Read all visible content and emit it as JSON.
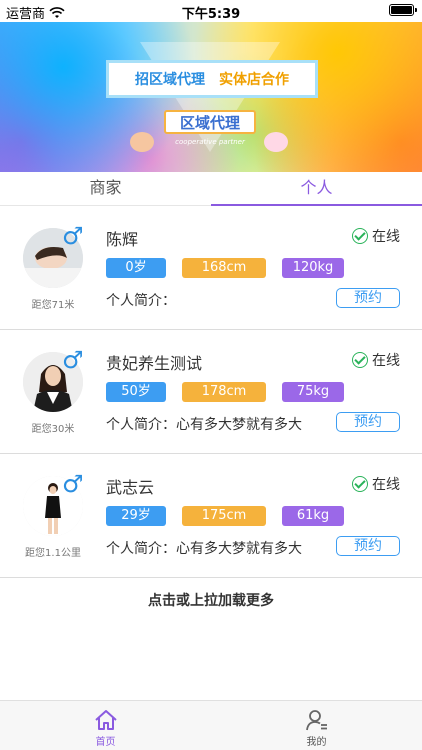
{
  "status_bar": {
    "carrier": "运营商",
    "time": "下午5:39"
  },
  "banner": {
    "headline_left": "招区域代理",
    "headline_right": "实体店合作",
    "subtitle": "区域代理",
    "caption": "cooperative partner"
  },
  "tabs": [
    {
      "label": "商家",
      "active": false
    },
    {
      "label": "个人",
      "active": true
    }
  ],
  "cards": [
    {
      "name": "陈辉",
      "status": "在线",
      "age": "0岁",
      "height": "168cm",
      "weight": "120kg",
      "intro_label": "个人简介：",
      "intro_text": "",
      "book_label": "预约",
      "distance": "距您71米",
      "gender_symbol": "♂"
    },
    {
      "name": "贵妃养生测试",
      "status": "在线",
      "age": "50岁",
      "height": "178cm",
      "weight": "75kg",
      "intro_label": "个人简介：",
      "intro_text": "心有多大梦就有多大",
      "book_label": "预约",
      "distance": "距您30米",
      "gender_symbol": "♂"
    },
    {
      "name": "武志云",
      "status": "在线",
      "age": "29岁",
      "height": "175cm",
      "weight": "61kg",
      "intro_label": "个人简介：",
      "intro_text": "心有多大梦就有多大",
      "book_label": "预约",
      "distance": "距您1.1公里",
      "gender_symbol": "♂"
    }
  ],
  "load_more": "点击或上拉加载更多",
  "bottom_nav": [
    {
      "label": "首页",
      "icon": "home-icon",
      "active": true
    },
    {
      "label": "我的",
      "icon": "user-icon",
      "active": false
    }
  ],
  "colors": {
    "accent": "#8a5ae0",
    "blue": "#3d9df2",
    "orange": "#f5b23c",
    "purple": "#9b68e8",
    "online": "#2ab35a"
  }
}
